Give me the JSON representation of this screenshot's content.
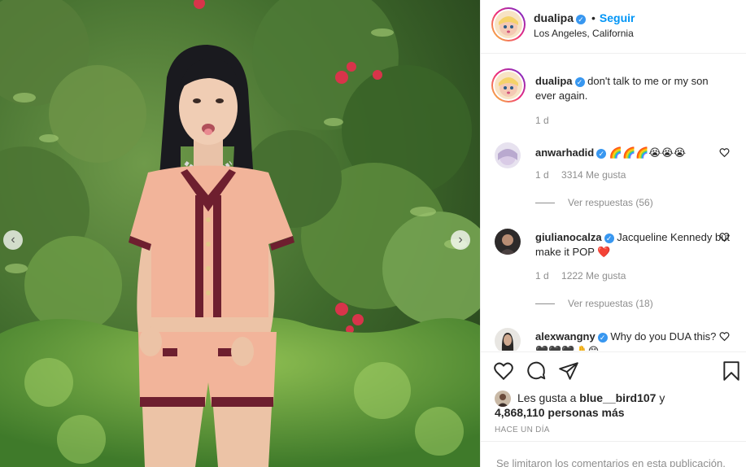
{
  "post": {
    "username": "dualipa",
    "follow_dot": "•",
    "follow_label": "Seguir",
    "location": "Los Angeles, California",
    "caption": "don't talk to me or my son ever again.",
    "caption_time": "1 d",
    "verified_mark": "✓"
  },
  "comments": [
    {
      "username": "anwarhadid",
      "text": "🌈🌈🌈😭😭😭",
      "time": "1 d",
      "likes": "3314 Me gusta",
      "replies": "Ver respuestas (56)"
    },
    {
      "username": "giulianocalza",
      "text": "Jacqueline Kennedy but make it POP ❤️",
      "time": "1 d",
      "likes": "1222 Me gusta",
      "replies": "Ver respuestas (18)"
    },
    {
      "username": "alexwangny",
      "text": "Why do you DUA this? 🖤🖤🖤🤚😊"
    }
  ],
  "footer": {
    "liked_by_prefix": "Les gusta a",
    "liked_by_user": "blue__bird107",
    "liked_by_and": "y",
    "liked_count": "4,868,110 personas más",
    "timestamp": "HACE UN DÍA",
    "comments_closed": "Se limitaron los comentarios en esta publicación."
  },
  "icons": {
    "prev": "chevron-left-icon",
    "next": "chevron-right-icon",
    "like": "heart-icon",
    "comment": "comment-icon",
    "share": "paper-plane-icon",
    "save": "bookmark-icon"
  },
  "colors": {
    "accent": "#0095f6",
    "verified": "#3897f0",
    "muted": "#8e8e8e",
    "outfit_peach": "#f2b49a",
    "outfit_trim": "#6e1f2f"
  }
}
